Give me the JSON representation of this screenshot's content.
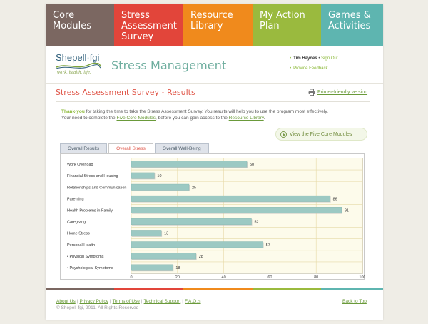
{
  "nav": {
    "items": [
      {
        "lines": [
          "Core Modules"
        ],
        "color": "#7b6761"
      },
      {
        "lines": [
          "Stress",
          "Assessment",
          "Survey"
        ],
        "color": "#e2453a"
      },
      {
        "lines": [
          "Resource",
          "Library"
        ],
        "color": "#f08a1c"
      },
      {
        "lines": [
          "My Action",
          "Plan"
        ],
        "color": "#9aba3e"
      },
      {
        "lines": [
          "Games &",
          "Activities"
        ],
        "color": "#5eb5b0"
      }
    ]
  },
  "header": {
    "logo_name": "Shepell·fgi",
    "logo_tagline": "work. health. life.",
    "title": "Stress Management",
    "user_name": "Tim Haynes",
    "sign_out": "Sign Out",
    "provide_feedback": "Provide Feedback"
  },
  "content": {
    "title": "Stress Assessment Survey - Results",
    "print_label": "Printer-friendly version",
    "intro_lead": "Thank-you",
    "intro_line1_rest": " for taking the time to take the Stress Assessment Survey. You results will help you to use the program most effectively.",
    "intro_line2_a": "Your need to complete the ",
    "intro_link1": "Five Core Modules",
    "intro_line2_b": ", before you can gain access to the ",
    "intro_link2": "Resource Library",
    "intro_line2_c": ".",
    "cta_label": "View the Five Core Modules"
  },
  "tabs": [
    {
      "label": "Overall Results",
      "active": false
    },
    {
      "label": "Overall Stress",
      "active": true
    },
    {
      "label": "Overall Well-Being",
      "active": false
    }
  ],
  "chart_data": {
    "type": "bar",
    "orientation": "horizontal",
    "categories": [
      "Work Overload",
      "Financial Stress and Housing",
      "Relationships and Communication",
      "Parenting",
      "Health Problems in Family",
      "Caregiving",
      "Home Stress",
      "Personal Health",
      "• Physical Symptoms",
      "• Psychological Symptoms"
    ],
    "values": [
      50,
      10,
      25,
      86,
      91,
      52,
      13,
      57,
      28,
      18
    ],
    "xlim": [
      0,
      100
    ],
    "xticks": [
      0,
      20,
      40,
      60,
      80,
      100
    ],
    "grid": true,
    "bar_color": "#9cc9c3",
    "grid_color": "#e6d9a6"
  },
  "footer": {
    "links": [
      "About Us",
      "Privacy Policy",
      "Terms of Use",
      "Technical Support",
      "F.A.Q.'s"
    ],
    "copyright": "© Shepell·fgi, 2011. All Rights Reserved",
    "back_to_top": "Back to Top"
  }
}
